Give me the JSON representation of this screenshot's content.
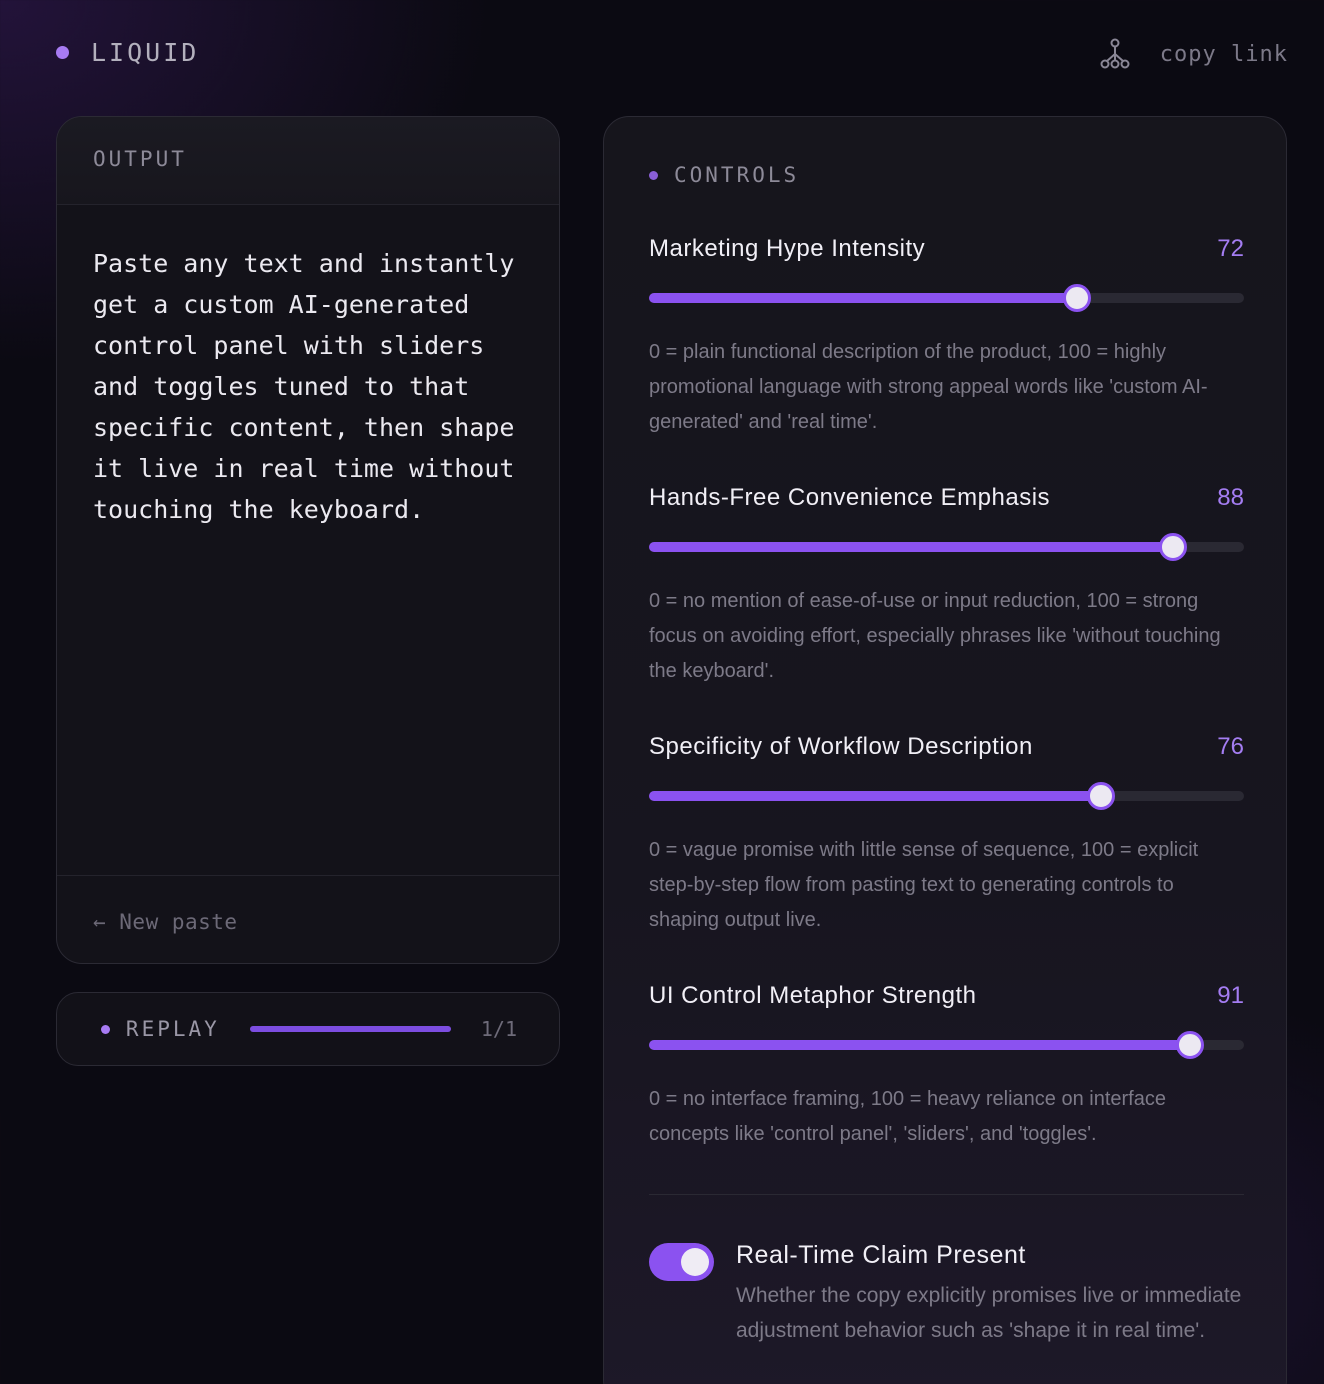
{
  "header": {
    "brand": "LIQUID",
    "share_icon": "network-share-icon",
    "share_label": "copy link"
  },
  "output": {
    "title": "OUTPUT",
    "text": "Paste any text and instantly get a custom AI-generated control panel with sliders and toggles tuned to that specific content, then shape it live in real time without touching the keyboard.",
    "footer_action": "← New paste"
  },
  "replay": {
    "label": "REPLAY",
    "progress": 1.0,
    "count": "1/1"
  },
  "controls": {
    "title": "CONTROLS",
    "sliders": [
      {
        "label": "Marketing Hype Intensity",
        "value": "72",
        "level": 72,
        "description": "0 = plain functional description of the product, 100 = highly promotional language with strong appeal words like 'custom AI-generated' and 'real time'."
      },
      {
        "label": "Hands-Free Convenience Emphasis",
        "value": "88",
        "level": 88,
        "description": "0 = no mention of ease-of-use or input reduction, 100 = strong focus on avoiding effort, especially phrases like 'without touching the keyboard'."
      },
      {
        "label": "Specificity of Workflow Description",
        "value": "76",
        "level": 76,
        "description": "0 = vague promise with little sense of sequence, 100 = explicit step-by-step flow from pasting text to generating controls to shaping output live."
      },
      {
        "label": "UI Control Metaphor Strength",
        "value": "91",
        "level": 91,
        "description": "0 = no interface framing, 100 = heavy reliance on interface concepts like 'control panel', 'sliders', and 'toggles'."
      }
    ],
    "toggle": {
      "label": "Real-Time Claim Present",
      "on": true,
      "description": "Whether the copy explicitly promises live or immediate adjustment behavior such as 'shape it in real time'."
    }
  },
  "colors": {
    "accent": "#8b52f0",
    "accent_text": "#a47df2",
    "background": "#0b0a12"
  }
}
